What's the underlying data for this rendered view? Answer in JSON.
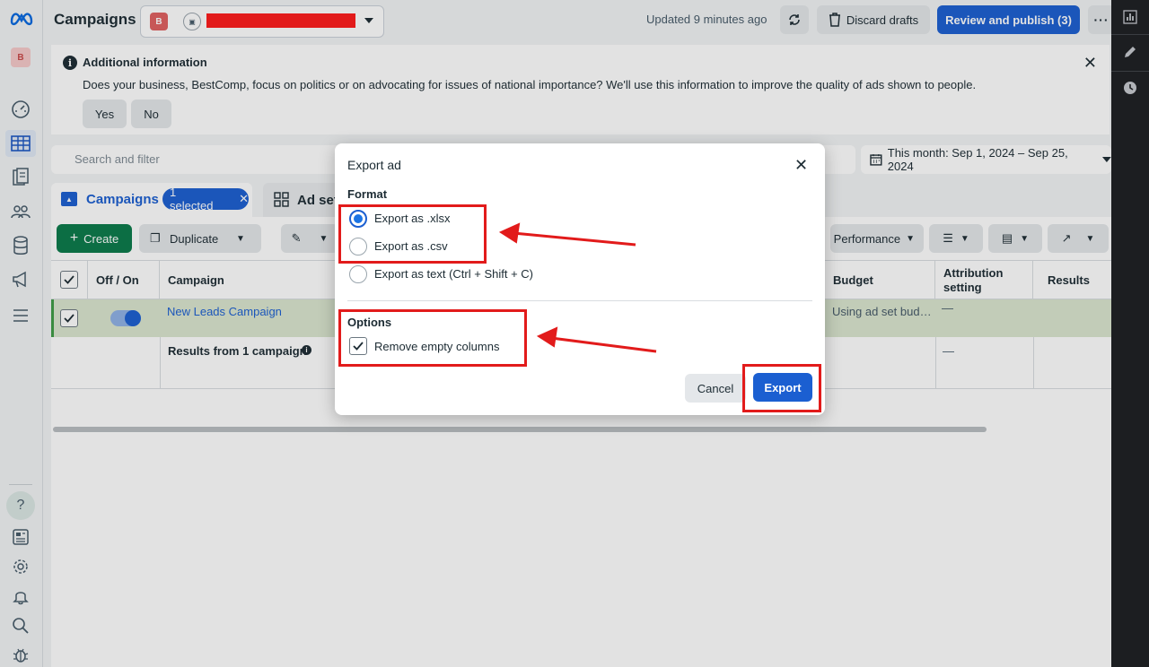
{
  "topbar": {
    "page_title": "Campaigns",
    "account_initial": "B",
    "updated_text": "Updated 9 minutes ago",
    "discard_label": "Discard drafts",
    "review_label": "Review and publish (3)"
  },
  "leftrail": {
    "avatar_initial": "B",
    "help_glyph": "?"
  },
  "banner": {
    "title": "Additional information",
    "text": "Does your business, BestComp, focus on politics or on advocating for issues of national importance? We'll use this information to improve the quality of ads shown to people.",
    "yes_label": "Yes",
    "no_label": "No"
  },
  "search": {
    "placeholder": "Search and filter"
  },
  "date_range": {
    "label": "This month: Sep 1, 2024 – Sep 25, 2024"
  },
  "tabs": {
    "campaigns_label": "Campaigns",
    "selected_pill": "1 selected",
    "adsets_label": "Ad set"
  },
  "toolbar": {
    "create_label": "Create",
    "duplicate_label": "Duplicate",
    "performance_label": "Performance"
  },
  "table": {
    "headers": {
      "offon": "Off / On",
      "campaign": "Campaign",
      "budget": "Budget",
      "attribution": "Attribution setting",
      "results": "Results"
    },
    "row": {
      "campaign_name": "New Leads Campaign",
      "budget": "Using ad set bud…",
      "attribution": "—"
    },
    "summary": {
      "label": "Results from 1 campaign",
      "attribution": "—"
    }
  },
  "dialog": {
    "title": "Export ad",
    "format_heading": "Format",
    "formats": [
      {
        "label": "Export as .xlsx",
        "selected": true
      },
      {
        "label": "Export as .csv",
        "selected": false
      },
      {
        "label": "Export as text (Ctrl + Shift + C)",
        "selected": false
      }
    ],
    "options_heading": "Options",
    "remove_empty_columns_label": "Remove empty columns",
    "remove_empty_columns_checked": true,
    "cancel_label": "Cancel",
    "export_label": "Export"
  },
  "colors": {
    "primary_blue": "#1b5fd1",
    "create_green": "#0a7a4a",
    "annotation_red": "#e21b1b",
    "selected_row": "#dbe6cf"
  }
}
